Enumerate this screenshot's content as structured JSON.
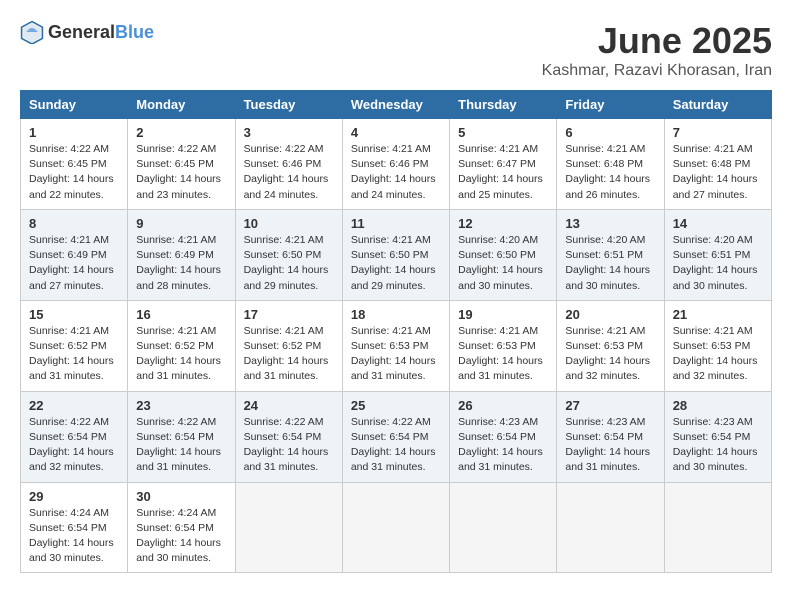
{
  "logo": {
    "general": "General",
    "blue": "Blue"
  },
  "title": "June 2025",
  "location": "Kashmar, Razavi Khorasan, Iran",
  "weekdays": [
    "Sunday",
    "Monday",
    "Tuesday",
    "Wednesday",
    "Thursday",
    "Friday",
    "Saturday"
  ],
  "weeks": [
    [
      {
        "day": "1",
        "sunrise": "4:22 AM",
        "sunset": "6:45 PM",
        "daylight": "14 hours and 22 minutes."
      },
      {
        "day": "2",
        "sunrise": "4:22 AM",
        "sunset": "6:45 PM",
        "daylight": "14 hours and 23 minutes."
      },
      {
        "day": "3",
        "sunrise": "4:22 AM",
        "sunset": "6:46 PM",
        "daylight": "14 hours and 24 minutes."
      },
      {
        "day": "4",
        "sunrise": "4:21 AM",
        "sunset": "6:46 PM",
        "daylight": "14 hours and 24 minutes."
      },
      {
        "day": "5",
        "sunrise": "4:21 AM",
        "sunset": "6:47 PM",
        "daylight": "14 hours and 25 minutes."
      },
      {
        "day": "6",
        "sunrise": "4:21 AM",
        "sunset": "6:48 PM",
        "daylight": "14 hours and 26 minutes."
      },
      {
        "day": "7",
        "sunrise": "4:21 AM",
        "sunset": "6:48 PM",
        "daylight": "14 hours and 27 minutes."
      }
    ],
    [
      {
        "day": "8",
        "sunrise": "4:21 AM",
        "sunset": "6:49 PM",
        "daylight": "14 hours and 27 minutes."
      },
      {
        "day": "9",
        "sunrise": "4:21 AM",
        "sunset": "6:49 PM",
        "daylight": "14 hours and 28 minutes."
      },
      {
        "day": "10",
        "sunrise": "4:21 AM",
        "sunset": "6:50 PM",
        "daylight": "14 hours and 29 minutes."
      },
      {
        "day": "11",
        "sunrise": "4:21 AM",
        "sunset": "6:50 PM",
        "daylight": "14 hours and 29 minutes."
      },
      {
        "day": "12",
        "sunrise": "4:20 AM",
        "sunset": "6:50 PM",
        "daylight": "14 hours and 30 minutes."
      },
      {
        "day": "13",
        "sunrise": "4:20 AM",
        "sunset": "6:51 PM",
        "daylight": "14 hours and 30 minutes."
      },
      {
        "day": "14",
        "sunrise": "4:20 AM",
        "sunset": "6:51 PM",
        "daylight": "14 hours and 30 minutes."
      }
    ],
    [
      {
        "day": "15",
        "sunrise": "4:21 AM",
        "sunset": "6:52 PM",
        "daylight": "14 hours and 31 minutes."
      },
      {
        "day": "16",
        "sunrise": "4:21 AM",
        "sunset": "6:52 PM",
        "daylight": "14 hours and 31 minutes."
      },
      {
        "day": "17",
        "sunrise": "4:21 AM",
        "sunset": "6:52 PM",
        "daylight": "14 hours and 31 minutes."
      },
      {
        "day": "18",
        "sunrise": "4:21 AM",
        "sunset": "6:53 PM",
        "daylight": "14 hours and 31 minutes."
      },
      {
        "day": "19",
        "sunrise": "4:21 AM",
        "sunset": "6:53 PM",
        "daylight": "14 hours and 31 minutes."
      },
      {
        "day": "20",
        "sunrise": "4:21 AM",
        "sunset": "6:53 PM",
        "daylight": "14 hours and 32 minutes."
      },
      {
        "day": "21",
        "sunrise": "4:21 AM",
        "sunset": "6:53 PM",
        "daylight": "14 hours and 32 minutes."
      }
    ],
    [
      {
        "day": "22",
        "sunrise": "4:22 AM",
        "sunset": "6:54 PM",
        "daylight": "14 hours and 32 minutes."
      },
      {
        "day": "23",
        "sunrise": "4:22 AM",
        "sunset": "6:54 PM",
        "daylight": "14 hours and 31 minutes."
      },
      {
        "day": "24",
        "sunrise": "4:22 AM",
        "sunset": "6:54 PM",
        "daylight": "14 hours and 31 minutes."
      },
      {
        "day": "25",
        "sunrise": "4:22 AM",
        "sunset": "6:54 PM",
        "daylight": "14 hours and 31 minutes."
      },
      {
        "day": "26",
        "sunrise": "4:23 AM",
        "sunset": "6:54 PM",
        "daylight": "14 hours and 31 minutes."
      },
      {
        "day": "27",
        "sunrise": "4:23 AM",
        "sunset": "6:54 PM",
        "daylight": "14 hours and 31 minutes."
      },
      {
        "day": "28",
        "sunrise": "4:23 AM",
        "sunset": "6:54 PM",
        "daylight": "14 hours and 30 minutes."
      }
    ],
    [
      {
        "day": "29",
        "sunrise": "4:24 AM",
        "sunset": "6:54 PM",
        "daylight": "14 hours and 30 minutes."
      },
      {
        "day": "30",
        "sunrise": "4:24 AM",
        "sunset": "6:54 PM",
        "daylight": "14 hours and 30 minutes."
      },
      null,
      null,
      null,
      null,
      null
    ]
  ]
}
